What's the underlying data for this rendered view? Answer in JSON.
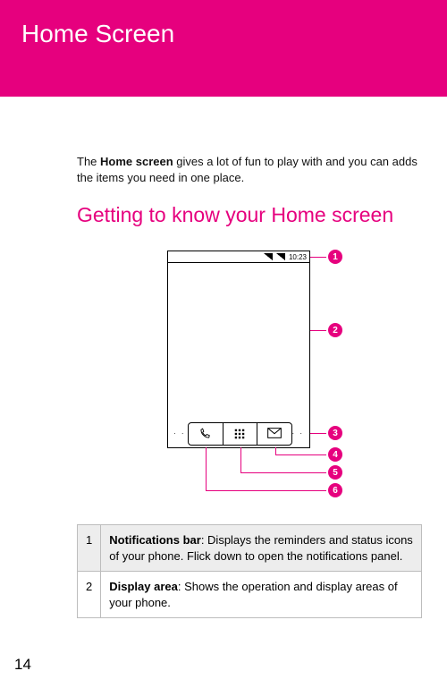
{
  "header": {
    "title": "Home Screen"
  },
  "intro": {
    "prefix": "The ",
    "bold": "Home screen",
    "rest": " gives a lot of fun to play with and you can adds the items you need in one place."
  },
  "section": {
    "title": "Getting to know your Home screen"
  },
  "phone": {
    "clock": "10:23"
  },
  "callouts": {
    "c1": "1",
    "c2": "2",
    "c3": "3",
    "c4": "4",
    "c5": "5",
    "c6": "6"
  },
  "legend": [
    {
      "num": "1",
      "term": "Notifications bar",
      "desc": ": Displays the reminders and status icons of your phone. Flick down to open the notifications panel."
    },
    {
      "num": "2",
      "term": "Display area",
      "desc": ": Shows the operation and display areas of your phone."
    }
  ],
  "page": "14"
}
